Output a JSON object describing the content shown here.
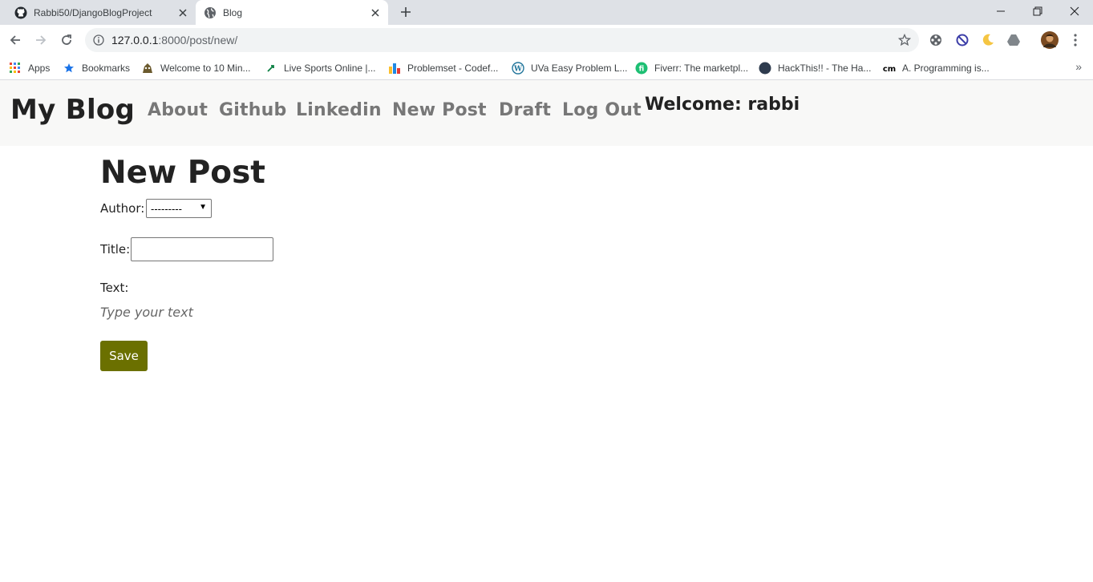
{
  "browser": {
    "tabs": [
      {
        "title": "Rabbi50/DjangoBlogProject",
        "icon": "github-icon"
      },
      {
        "title": "Blog",
        "icon": "globe-icon"
      }
    ],
    "url_host": "127.0.0.1",
    "url_path": ":8000/post/new/",
    "bookmarks": [
      {
        "label": "Apps",
        "icon": "apps-grid-icon"
      },
      {
        "label": "Bookmarks",
        "icon": "star-icon"
      },
      {
        "label": "Welcome to 10 Min...",
        "icon": "bookmark-favicon-icon"
      },
      {
        "label": "Live Sports Online |...",
        "icon": "bookmark-favicon-icon"
      },
      {
        "label": "Problemset - Codef...",
        "icon": "codeforces-icon"
      },
      {
        "label": "UVa Easy Problem L...",
        "icon": "wordpress-icon"
      },
      {
        "label": "Fiverr: The marketpl...",
        "icon": "fiverr-icon"
      },
      {
        "label": "HackThis!! - The Ha...",
        "icon": "bookmark-favicon-icon"
      },
      {
        "label": "A. Programming is...",
        "icon": "cm-icon"
      }
    ],
    "bookmarks_more": "»"
  },
  "site": {
    "brand": "My Blog",
    "nav": [
      "About",
      "Github",
      "Linkedin",
      "New Post",
      "Draft",
      "Log Out"
    ],
    "welcome": "Welcome: rabbi"
  },
  "form": {
    "title": "New Post",
    "author_label": "Author:",
    "author_value": "---------",
    "title_label": "Title:",
    "title_value": "",
    "text_label": "Text:",
    "text_placeholder": "Type your text",
    "save_label": "Save"
  },
  "colors": {
    "save_button": "#6b7000",
    "header_bg": "#f8f8f7",
    "nav_link": "#777777"
  }
}
